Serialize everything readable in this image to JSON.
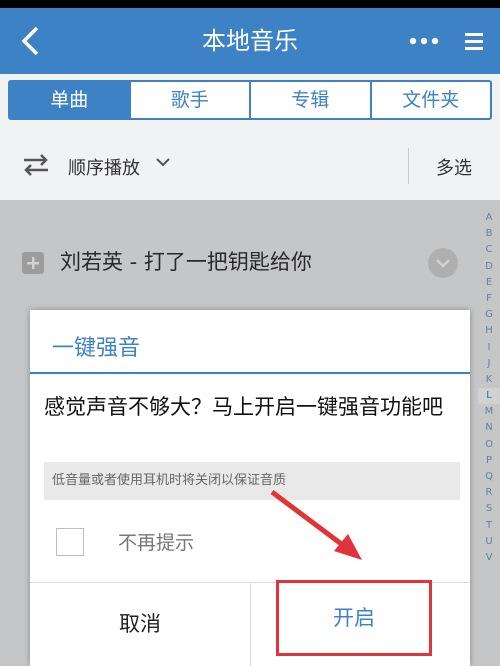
{
  "appbar": {
    "title": "本地音乐",
    "back_icon": "chevron-left-icon",
    "more_icon": "more-dots-icon",
    "menu_icon": "menu-icon"
  },
  "tabs": [
    {
      "label": "单曲",
      "active": true
    },
    {
      "label": "歌手",
      "active": false
    },
    {
      "label": "专辑",
      "active": false
    },
    {
      "label": "文件夹",
      "active": false
    }
  ],
  "toolbar": {
    "play_order": "顺序播放",
    "multi_select": "多选"
  },
  "list": {
    "visible_song": "刘若英 - 打了一把钥匙给你"
  },
  "az_index": [
    "A",
    "B",
    "C",
    "D",
    "E",
    "F",
    "G",
    "H",
    "I",
    "J",
    "K",
    "L",
    "M",
    "N",
    "O",
    "P",
    "Q",
    "R",
    "S",
    "T",
    "U",
    "V"
  ],
  "az_index_highlight": "L",
  "dialog": {
    "title": "一键强音",
    "message": "感觉声音不够大？马上开启一键强音功能吧",
    "note": "低音量或者使用耳机时将关闭以保证音质",
    "checkbox_label": "不再提示",
    "checkbox_checked": false,
    "cancel_label": "取消",
    "confirm_label": "开启"
  },
  "colors": {
    "accent": "#3e82c6",
    "highlight_border": "#e0333a"
  }
}
